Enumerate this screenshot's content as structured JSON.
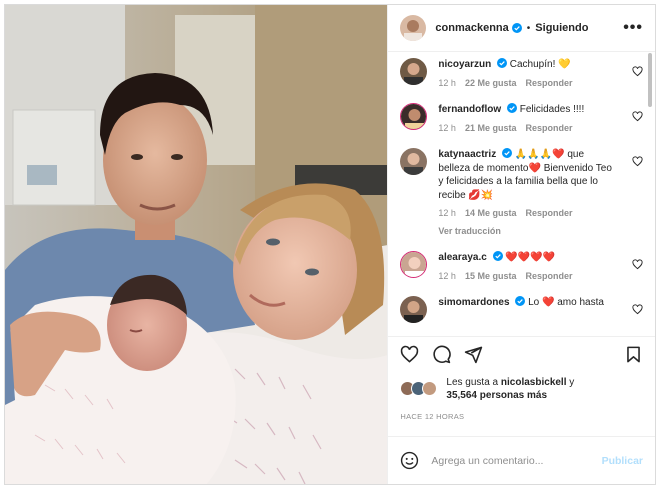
{
  "post": {
    "author": "conmackenna",
    "follow_label": "Siguiendo",
    "more_label": "•••",
    "separator": "•"
  },
  "comments": [
    {
      "user": "nicoyarzun",
      "text": "Cachupín! 💛",
      "time": "12 h",
      "likes": "22 Me gusta",
      "reply": "Responder",
      "avatar_color": "#6f5a45"
    },
    {
      "user": "fernandoflow",
      "text": "Felicidades !!!!",
      "time": "12 h",
      "likes": "21 Me gusta",
      "reply": "Responder",
      "avatar_color": "#3a2c2a"
    },
    {
      "user": "katynaactriz",
      "text": "🙏🙏🙏❤️ que belleza de momento❤️ Bienvenido Teo y felicidades a la familia bella que lo recibe 💋💥",
      "time": "12 h",
      "likes": "14 Me gusta",
      "reply": "Responder",
      "view_replies": "Ver traducción",
      "avatar_color": "#8a7363"
    },
    {
      "user": "alearaya.c",
      "text": "❤️❤️❤️❤️",
      "time": "12 h",
      "likes": "15 Me gusta",
      "reply": "Responder",
      "avatar_color": "#c9a592"
    },
    {
      "user": "simomardones",
      "text": "Lo ❤️ amo hasta",
      "time": "",
      "likes": "",
      "reply": "",
      "avatar_color": "#7b6150"
    }
  ],
  "likes": {
    "prefix": "Les gusta a",
    "user": "nicolasbickell",
    "suffix_connector": "y",
    "count": "35,564 personas más"
  },
  "time_ago": "HACE 12 HORAS",
  "add_comment": {
    "placeholder": "Agrega un comentario...",
    "publish_label": "Publicar"
  },
  "colors": {
    "verified": "#0095f6",
    "link_disabled": "#b2dffc",
    "muted": "#8e8e8e"
  },
  "icons": [
    "heart-icon",
    "comment-icon",
    "share-icon",
    "bookmark-icon",
    "emoji-icon",
    "verified-icon",
    "more-icon"
  ]
}
